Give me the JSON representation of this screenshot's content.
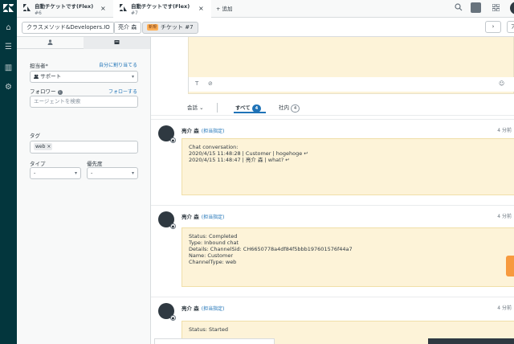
{
  "tabs": [
    {
      "title": "自動チケットです(Flex)",
      "sub": "#6",
      "close": "×"
    },
    {
      "title": "自動チケットです(Flex)",
      "sub": "#7",
      "close": "×"
    }
  ],
  "add_tab": "+ 追加",
  "breadcrumb": {
    "org": "クラスメソッド&Developers.IO",
    "user": "亮介 森",
    "status_badge": "新規",
    "ticket": "チケット #7",
    "next": "›",
    "apps": "アプリ"
  },
  "props": {
    "assignee_label": "担当者*",
    "assign_me": "自分に割り当てる",
    "assignee_value": "サポート",
    "followers_label": "フォロワー",
    "follow": "フォローする",
    "agent_search_placeholder": "エージェントを検索",
    "tags_label": "タグ",
    "tag": "web",
    "type_label": "タイプ",
    "type_value": "-",
    "priority_label": "優先度",
    "priority_value": "-"
  },
  "filters": {
    "conversation": "会話",
    "all": "すべて",
    "all_count": "4",
    "internal": "社内",
    "internal_count": "4"
  },
  "messages": [
    {
      "author": "亮介 森",
      "role": "(担当指定)",
      "time": "4 分前",
      "lines": [
        "Chat conversation:",
        "",
        "2020/4/15 11:48:28 | Customer | hogehoge ↵",
        "",
        "2020/4/15 11:48:47 | 亮介 森 | what? ↵"
      ]
    },
    {
      "author": "亮介 森",
      "role": "(担当指定)",
      "time": "4 分前",
      "lines": [
        "Status: Completed",
        "Type: Inbound chat",
        "Details: ChannelSid: CH6650778a4df84f5bbb197601576f44a7",
        "Name: Customer",
        "ChannelType: web"
      ]
    },
    {
      "author": "亮介 森",
      "role": "(担当指定)",
      "time": "4 分前",
      "lines": [
        "Status: Started"
      ]
    }
  ],
  "icons": [
    "zendesk-logo-icon",
    "home-icon",
    "views-icon",
    "reporting-icon",
    "admin-icon",
    "search-icon",
    "apps-icon",
    "grid-icon",
    "user-icon",
    "ticket-icon",
    "text-format-icon",
    "attachment-icon",
    "emoji-icon"
  ]
}
